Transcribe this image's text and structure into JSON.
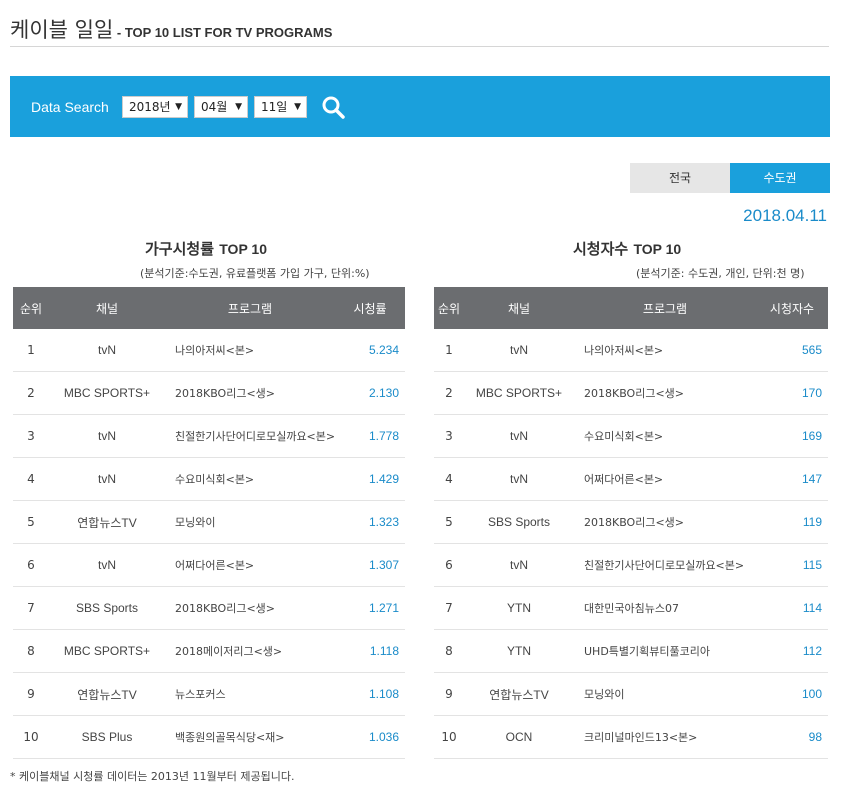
{
  "header": {
    "title": "케이블 일일",
    "subtitle": " - TOP 10 LIST FOR TV PROGRAMS"
  },
  "search": {
    "label": "Data Search",
    "year": "2018년",
    "month": "04월",
    "day": "11일",
    "icon": "search-icon",
    "bg_color": "#1aa0dc"
  },
  "region_tabs": [
    {
      "label": "전국",
      "active": false
    },
    {
      "label": "수도권",
      "active": true
    }
  ],
  "date": "2018.04.11",
  "household": {
    "title_ko": "가구시청률",
    "title_en": "TOP 10",
    "note": "(분석기준:수도권, 유료플랫폼 가입 가구, 단위:%)",
    "headers": [
      "순위",
      "채널",
      "프로그램",
      "시청률"
    ],
    "rows": [
      [
        "1",
        "tvN",
        "나의아저씨<본>",
        "5.234"
      ],
      [
        "2",
        "MBC SPORTS+",
        "2018KBO리그<생>",
        "2.130"
      ],
      [
        "3",
        "tvN",
        "친절한기사단어디로모실까요<본>",
        "1.778"
      ],
      [
        "4",
        "tvN",
        "수요미식회<본>",
        "1.429"
      ],
      [
        "5",
        "연합뉴스TV",
        "모닝와이",
        "1.323"
      ],
      [
        "6",
        "tvN",
        "어쩌다어른<본>",
        "1.307"
      ],
      [
        "7",
        "SBS Sports",
        "2018KBO리그<생>",
        "1.271"
      ],
      [
        "8",
        "MBC SPORTS+",
        "2018메이저리그<생>",
        "1.118"
      ],
      [
        "9",
        "연합뉴스TV",
        "뉴스포커스",
        "1.108"
      ],
      [
        "10",
        "SBS Plus",
        "백종원의골목식당<재>",
        "1.036"
      ]
    ]
  },
  "viewers": {
    "title_ko": "시청자수",
    "title_en": "TOP 10",
    "note": "(분석기준: 수도권, 개인, 단위:천 명)",
    "headers": [
      "순위",
      "채널",
      "프로그램",
      "시청자수"
    ],
    "rows": [
      [
        "1",
        "tvN",
        "나의아저씨<본>",
        "565"
      ],
      [
        "2",
        "MBC SPORTS+",
        "2018KBO리그<생>",
        "170"
      ],
      [
        "3",
        "tvN",
        "수요미식회<본>",
        "169"
      ],
      [
        "4",
        "tvN",
        "어쩌다어른<본>",
        "147"
      ],
      [
        "5",
        "SBS Sports",
        "2018KBO리그<생>",
        "119"
      ],
      [
        "6",
        "tvN",
        "친절한기사단어디로모실까요<본>",
        "115"
      ],
      [
        "7",
        "YTN",
        "대한민국아침뉴스07",
        "114"
      ],
      [
        "8",
        "YTN",
        "UHD특별기획뷰티풀코리아",
        "112"
      ],
      [
        "9",
        "연합뉴스TV",
        "모닝와이",
        "100"
      ],
      [
        "10",
        "OCN",
        "크리미널마인드13<본>",
        "98"
      ]
    ]
  },
  "footnote": "* 케이블채널 시청률 데이터는 2013년 11월부터 제공됩니다."
}
